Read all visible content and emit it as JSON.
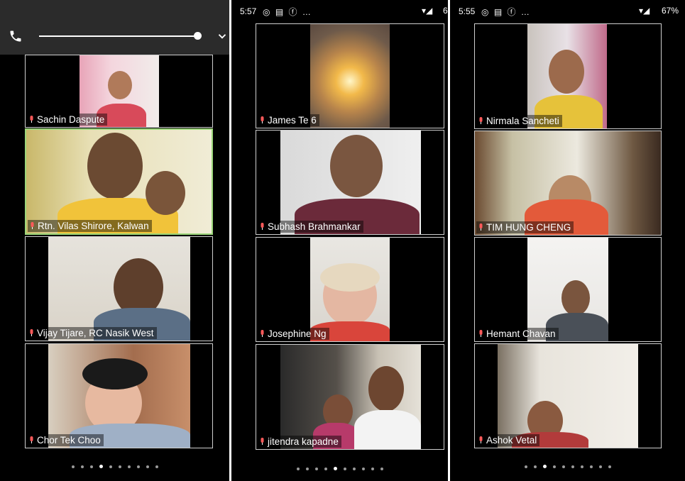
{
  "panels": [
    {
      "time": "",
      "call_controls": {
        "icons": [
          "phone-icon",
          "volume-slider",
          "chevron-down-icon"
        ]
      },
      "participants": [
        "Sachin Daspute",
        "Rtn. Vilas Shirore, Kalwan",
        "Vijay Tijare, RC  Nasik West",
        "Chor Tek Choo"
      ],
      "active_speaker_index": 1,
      "page_dots": 10,
      "current_page": 3
    },
    {
      "time": "5:57",
      "status_icons": [
        "whatsapp-icon",
        "news-icon",
        "facebook-icon",
        "more-dots"
      ],
      "battery": "6",
      "participants": [
        "James Te 6",
        "Subhash Brahmankar",
        "Josephine Ng",
        "jitendra kapadne"
      ],
      "page_dots": 10,
      "current_page": 4
    },
    {
      "time": "5:55",
      "status_icons": [
        "whatsapp-icon",
        "news-icon",
        "facebook-icon",
        "more-dots"
      ],
      "battery": "67%",
      "participants": [
        "Nirmala Sancheti",
        "TIM HUNG CHENG",
        "Hemant Chavan",
        "Ashok Vetal"
      ],
      "page_dots": 10,
      "current_page": 2
    }
  ],
  "colors": {
    "background": "#000000",
    "tile_border": "#cfcfcf",
    "active_border": "#9bd67a",
    "call_bar": "#2b2b2b"
  }
}
